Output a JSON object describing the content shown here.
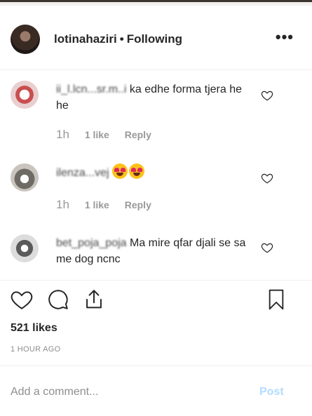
{
  "header": {
    "username": "lotinahaziri",
    "separator": "•",
    "follow_status": "Following",
    "more_icon": "more-horizontal-icon"
  },
  "comments": [
    {
      "username": "ii_l.lcn...sr.m..i",
      "text": "ka edhe forma tjera he he",
      "time": "1h",
      "likes": "1 like",
      "reply": "Reply"
    },
    {
      "username": "ilenza...vej",
      "text": "",
      "emoji": "heart-eyes-emoji",
      "time": "1h",
      "likes": "1 like",
      "reply": "Reply"
    },
    {
      "username": "bet_poja_poja",
      "text": "Ma mire qfar djali se sa me dog ncnc",
      "time": "",
      "likes": "",
      "reply": ""
    }
  ],
  "actions": {
    "like_icon": "heart-icon",
    "comment_icon": "comment-icon",
    "share_icon": "share-icon",
    "save_icon": "bookmark-icon"
  },
  "likes_count": "521 likes",
  "time_ago": "1 HOUR AGO",
  "add_comment": {
    "placeholder": "Add a comment...",
    "post_label": "Post"
  },
  "colors": {
    "text": "#262626",
    "muted": "#999999",
    "post_disabled": "#b3dbff",
    "divider": "#efefef"
  }
}
